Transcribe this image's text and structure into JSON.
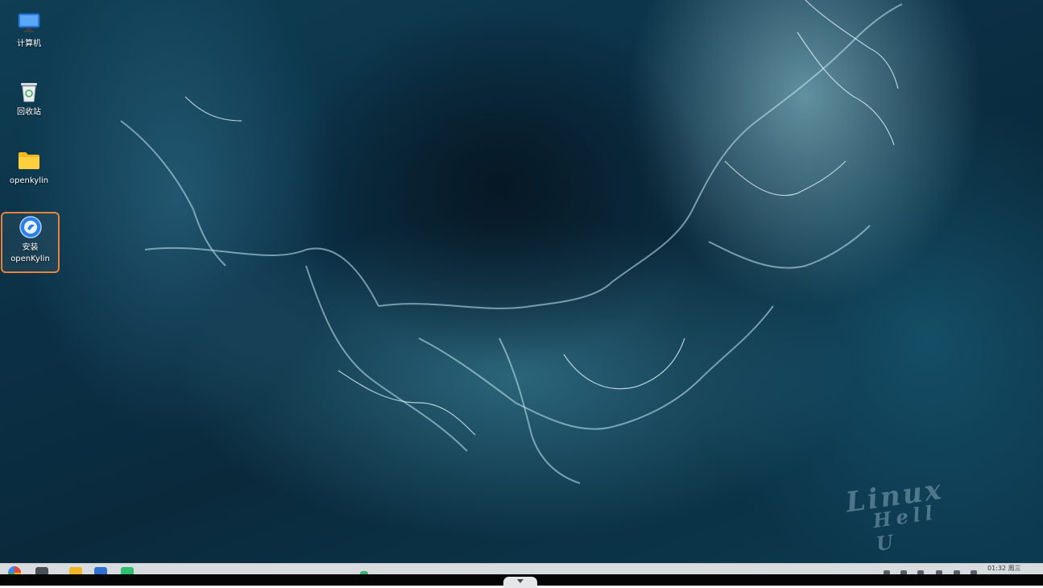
{
  "desktop": {
    "icons": [
      {
        "label": "计算机",
        "icon": "computer-icon"
      },
      {
        "label": "回收站",
        "icon": "trash-icon"
      },
      {
        "label": "openkylin",
        "icon": "folder-icon"
      },
      {
        "label": "安装\nopenKylin",
        "icon": "installer-icon",
        "selected": true
      }
    ],
    "watermark": {
      "line1": "Linux",
      "line2": "Hell U"
    }
  },
  "taskbar": {
    "start_icon": "start-menu-icon",
    "apps": [
      "multitask-view-icon",
      "file-manager-icon",
      "web-browser-icon",
      "software-center-icon",
      "app-icon"
    ],
    "clock": {
      "time": "01:32 周三"
    }
  },
  "colors": {
    "accent_selection": "#e8843a",
    "taskbar_bg": "#d8dcdf"
  }
}
